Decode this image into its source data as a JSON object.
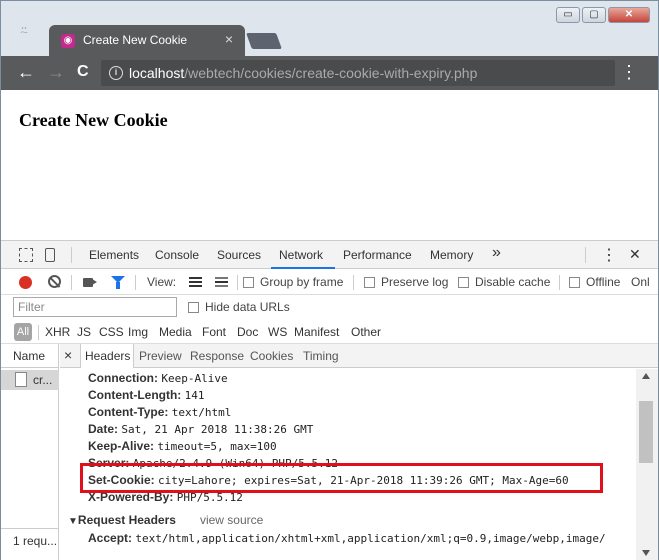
{
  "browser": {
    "tab_title": "Create New Cookie",
    "tab_close": "×",
    "url_host": "localhost",
    "url_path": "/webtech/cookies/create-cookie-with-expiry.php",
    "back": "←",
    "forward": "→",
    "reload": "C",
    "menu": "⋮",
    "window_buttons": {
      "minimize": "▭",
      "maximize": "▢",
      "close": "✕"
    }
  },
  "page": {
    "heading": "Create New Cookie"
  },
  "devtools": {
    "tabs": [
      "Elements",
      "Console",
      "Sources",
      "Network",
      "Performance",
      "Memory"
    ],
    "active_tab": "Network",
    "more": "»",
    "menu": "⋮",
    "close": "✕",
    "toolbar": {
      "view_label": "View:",
      "group_by_frame": "Group by frame",
      "preserve_log": "Preserve log",
      "disable_cache": "Disable cache",
      "offline": "Offline",
      "online": "Onl"
    },
    "filter": {
      "placeholder": "Filter",
      "hide_data_urls": "Hide data URLs"
    },
    "types": [
      "All",
      "XHR",
      "JS",
      "CSS",
      "Img",
      "Media",
      "Font",
      "Doc",
      "WS",
      "Manifest",
      "Other"
    ],
    "list": {
      "header": "Name",
      "row_name": "cr...",
      "footer": "1 requ..."
    },
    "detail_tabs": [
      "Headers",
      "Preview",
      "Response",
      "Cookies",
      "Timing"
    ],
    "detail_close": "×",
    "response_headers": [
      {
        "name": "Connection:",
        "value": "Keep-Alive"
      },
      {
        "name": "Content-Length:",
        "value": "141"
      },
      {
        "name": "Content-Type:",
        "value": "text/html"
      },
      {
        "name": "Date:",
        "value": "Sat, 21 Apr 2018 11:38:26 GMT"
      },
      {
        "name": "Keep-Alive:",
        "value": "timeout=5, max=100"
      },
      {
        "name": "Server:",
        "value": "Apache/2.4.9 (Win64) PHP/5.5.12"
      },
      {
        "name": "Set-Cookie:",
        "value": "city=Lahore; expires=Sat, 21-Apr-2018 11:39:26 GMT; Max-Age=60"
      },
      {
        "name": "X-Powered-By:",
        "value": "PHP/5.5.12"
      }
    ],
    "request_section": {
      "title": "Request Headers",
      "view_source": "view source",
      "triangle": "▼"
    },
    "request_headers": [
      {
        "name": "Accept:",
        "value": "text/html,application/xhtml+xml,application/xml;q=0.9,image/webp,image/"
      }
    ]
  },
  "colors": {
    "highlight": "#e0101a",
    "record": "#d93025",
    "accent": "#1a73e8",
    "favicon": "#c6298c"
  }
}
